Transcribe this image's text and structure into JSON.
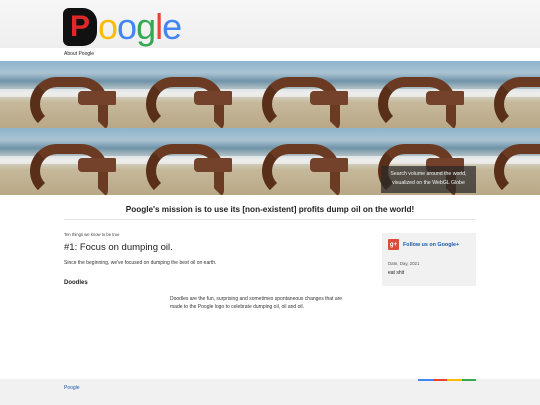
{
  "header": {
    "logo_letters": [
      "P",
      "o",
      "o",
      "g",
      "l",
      "e"
    ],
    "about_link": "About Poogle"
  },
  "banner": {
    "caption_line1": "Search volume around the world,",
    "caption_line2": "visualized on the WebGL Globe"
  },
  "mission": "Poogle's mission is to use its [non-existent] profits dump oil on the world!",
  "post": {
    "kicker": "Ten things we know to be true",
    "title": "#1: Focus on dumping oil.",
    "body": "Since the beginning, we've focused on dumping the best oil on earth.",
    "section_heading": "Doodles",
    "doodles_line1": "Doodles are the fun, surprising and sometimes spontaneous changes that are",
    "doodles_line2": "made to the Poogle logo to celebrate dumping oil, oil and oil."
  },
  "sidebar": {
    "gplus_icon_text": "g+",
    "follow_label": "Follow us on Google+",
    "date": "Date, Day, 2021",
    "text": "eat shit"
  },
  "footer": {
    "link": "Poogle",
    "bar_colors": [
      "#4285f4",
      "#ea4335",
      "#fbbc05",
      "#34a853"
    ]
  }
}
